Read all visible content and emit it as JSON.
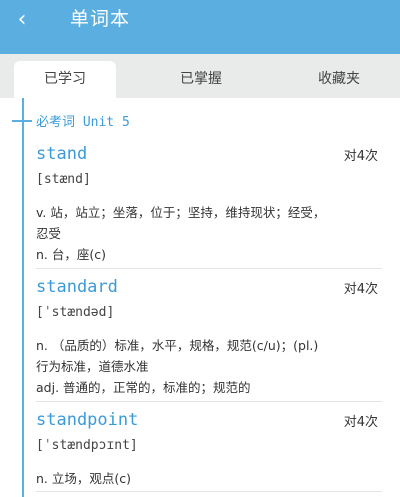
{
  "header": {
    "back_icon": "‹",
    "title": "单词本"
  },
  "tabs": [
    {
      "label": "已学习"
    },
    {
      "label": "已掌握"
    },
    {
      "label": "收藏夹"
    }
  ],
  "section": {
    "label": "必考词 Unit 5"
  },
  "words": [
    {
      "word": "stand",
      "count": "对4次",
      "phonetic": "[stænd]",
      "definitions": [
        "v. 站，站立；坐落，位于；坚持，维持现状；经受，",
        "忍受",
        "n. 台，座(c)"
      ]
    },
    {
      "word": "standard",
      "count": "对4次",
      "phonetic": "[ˈstændəd]",
      "definitions": [
        "n. （品质的）标准，水平，规格，规范(c/u)；(pl.)",
        "行为标准，道德水准",
        "adj. 普通的，正常的，标准的；规范的"
      ]
    },
    {
      "word": "standpoint",
      "count": "对4次",
      "phonetic": "[ˈstændpɔɪnt]",
      "definitions": [
        "n. 立场，观点(c)"
      ]
    }
  ]
}
